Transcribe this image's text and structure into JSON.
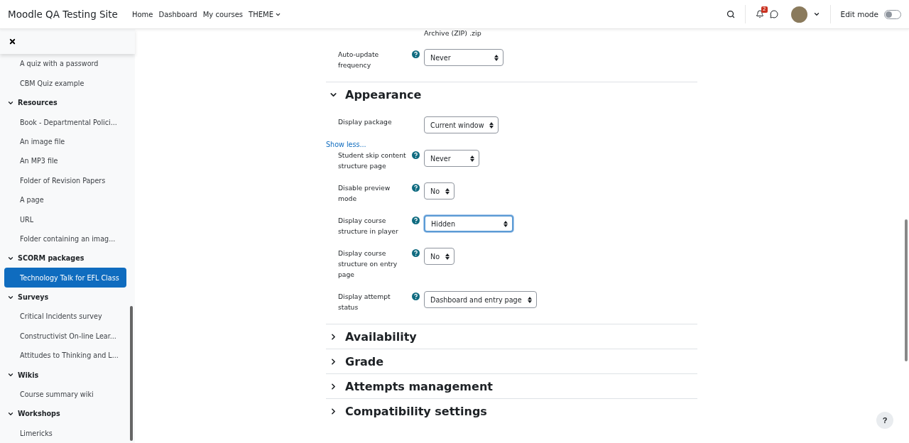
{
  "navbar": {
    "brand": "Moodle QA Testing Site",
    "links": [
      {
        "label": "Home",
        "dropdown": false
      },
      {
        "label": "Dashboard",
        "dropdown": false
      },
      {
        "label": "My courses",
        "dropdown": false
      },
      {
        "label": "THEME",
        "dropdown": true
      }
    ],
    "notification_count": "2",
    "edit_mode": {
      "label": "Edit mode",
      "on": false
    }
  },
  "sidebar": {
    "items": [
      {
        "kind": "item",
        "label": "A quiz with a password",
        "selected": false
      },
      {
        "kind": "item",
        "label": "CBM Quiz example",
        "selected": false
      },
      {
        "kind": "section",
        "label": "Resources",
        "expanded": true
      },
      {
        "kind": "item",
        "label": "Book - Departmental Polici...",
        "selected": false
      },
      {
        "kind": "item",
        "label": "An image file",
        "selected": false
      },
      {
        "kind": "item",
        "label": "An MP3 file",
        "selected": false
      },
      {
        "kind": "item",
        "label": "Folder of Revision Papers",
        "selected": false
      },
      {
        "kind": "item",
        "label": "A page",
        "selected": false
      },
      {
        "kind": "item",
        "label": "URL",
        "selected": false
      },
      {
        "kind": "item",
        "label": "Folder containing an imag...",
        "selected": false
      },
      {
        "kind": "section",
        "label": "SCORM packages",
        "expanded": true
      },
      {
        "kind": "item",
        "label": "Technology Talk for EFL Class",
        "selected": true
      },
      {
        "kind": "section",
        "label": "Surveys",
        "expanded": true
      },
      {
        "kind": "item",
        "label": "Critical Incidents survey",
        "selected": false
      },
      {
        "kind": "item",
        "label": "Constructivist On-line Lear...",
        "selected": false
      },
      {
        "kind": "item",
        "label": "Attitudes to Thinking and L...",
        "selected": false
      },
      {
        "kind": "section",
        "label": "Wikis",
        "expanded": true
      },
      {
        "kind": "item",
        "label": "Course summary wiki",
        "selected": false
      },
      {
        "kind": "section",
        "label": "Workshops",
        "expanded": true
      },
      {
        "kind": "item",
        "label": "Limericks",
        "selected": false
      }
    ]
  },
  "form": {
    "top_text": "Archive (ZIP) .zip",
    "top_fields": [
      {
        "label": "Auto-update frequency",
        "help": true,
        "value": "Never",
        "focused": false
      }
    ],
    "sections": [
      {
        "title": "Appearance",
        "expanded": true,
        "fields": [
          {
            "label": "Display package",
            "help": false,
            "value": "Current window",
            "focused": false
          }
        ],
        "show_less": "Show less...",
        "advanced_fields": [
          {
            "label": "Student skip content structure page",
            "help": true,
            "value": "Never",
            "focused": false
          },
          {
            "label": "Disable preview mode",
            "help": true,
            "value": "No",
            "focused": false
          },
          {
            "label": "Display course structure in player",
            "help": true,
            "value": "Hidden",
            "focused": true
          },
          {
            "label": "Display course structure on entry page",
            "help": true,
            "value": "No",
            "focused": false
          },
          {
            "label": "Display attempt status",
            "help": true,
            "value": "Dashboard and entry page",
            "focused": false
          }
        ]
      },
      {
        "title": "Availability",
        "expanded": false
      },
      {
        "title": "Grade",
        "expanded": false
      },
      {
        "title": "Attempts management",
        "expanded": false
      },
      {
        "title": "Compatibility settings",
        "expanded": false
      }
    ]
  },
  "help_button": "?"
}
